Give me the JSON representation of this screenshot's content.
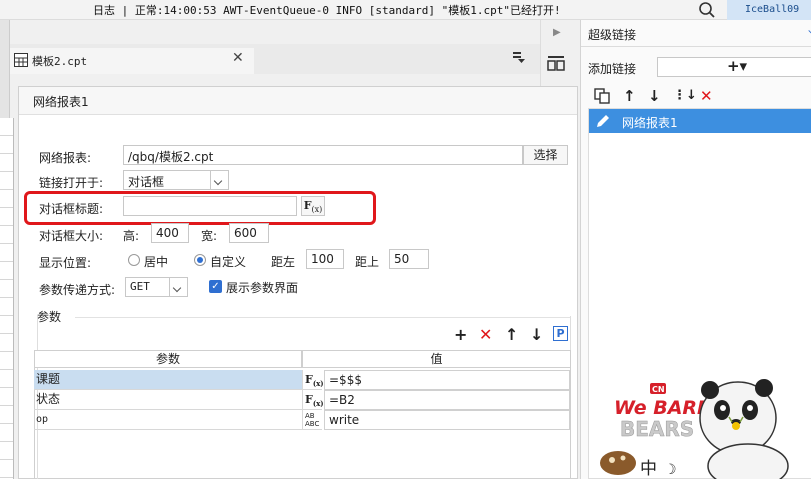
{
  "topbar": {
    "log": "日志 | 正常:14:00:53 AWT-EventQueue-0 INFO [standard] \"模板1.cpt\"已经打开!",
    "user": "IceBall09"
  },
  "tab": {
    "label": "模板2.cpt"
  },
  "dialog": {
    "title": "网络报表1",
    "report_label": "网络报表:",
    "report_value": "/qbq/模板2.cpt",
    "choose_button": "选择",
    "open_in_label": "链接打开于:",
    "open_in_value": "对话框",
    "dialog_title_label": "对话框标题:",
    "dialog_title_value": "",
    "fx_label": "F(x)",
    "size_label": "对话框大小:",
    "height_label": "高:",
    "height_value": "400",
    "width_label": "宽:",
    "width_value": "600",
    "position_label": "显示位置:",
    "center_label": "居中",
    "custom_label": "自定义",
    "left_label": "距左",
    "left_value": "100",
    "top_label": "距上",
    "top_value": "50",
    "method_label": "参数传递方式:",
    "method_value": "GET",
    "show_params_label": "展示参数界面",
    "show_params_checked": true,
    "params_section": "参数",
    "columns": [
      "参数",
      "值"
    ],
    "rows": [
      {
        "name": "课题",
        "type": "F(x)",
        "value": "=$$$",
        "selected": true
      },
      {
        "name": "状态",
        "type": "F(x)",
        "value": "=B2",
        "selected": false
      },
      {
        "name": "op",
        "type": "ABC",
        "value": "write",
        "selected": false
      }
    ]
  },
  "right_panel": {
    "title": "超级链接",
    "add_label": "添加链接",
    "add_symbol": "+▾",
    "items": [
      {
        "label": "网络报表1",
        "selected": true
      }
    ]
  },
  "mascot": {
    "logo_top": "CN",
    "logo_line1": "We BARE",
    "logo_line2": "BEARS",
    "ime_text": "中"
  },
  "colors": {
    "accent": "#2f6fd1",
    "highlight_red": "#e0171b",
    "selected_row": "#c9ddf0",
    "list_selected": "#3d8fe0"
  }
}
